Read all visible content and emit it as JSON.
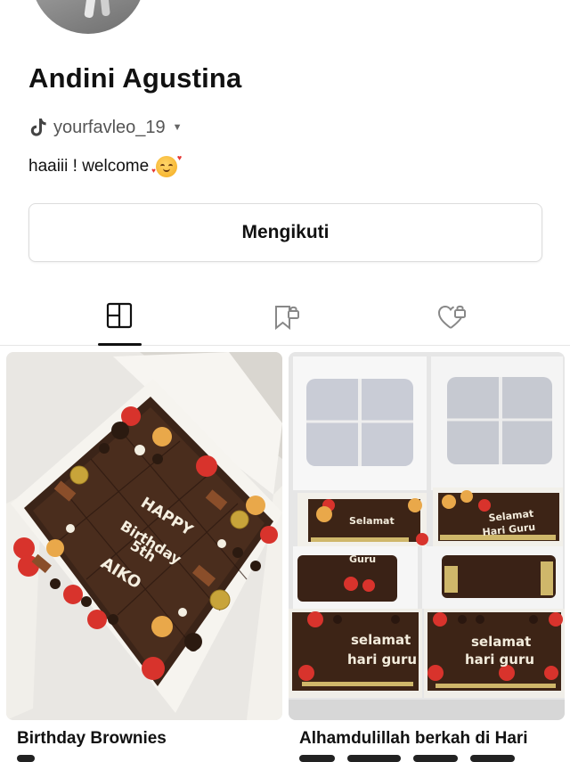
{
  "profile": {
    "name": "Andini Agustina",
    "handle": "yourfavleo_19",
    "bio": "haaiii ! welcome",
    "bio_emoji": "smiling-face-with-hearts"
  },
  "actions": {
    "follow_label": "Mengikuti"
  },
  "tabs": [
    {
      "id": "grid",
      "icon": "grid-layout-icon",
      "active": true
    },
    {
      "id": "saved",
      "icon": "bookmark-lock-icon",
      "active": false
    },
    {
      "id": "liked",
      "icon": "heart-lock-icon",
      "active": false
    }
  ],
  "posts": [
    {
      "title": "Birthday Brownies",
      "image": "brownie box with HAPPY BIRTHDAY 5th AIKO"
    },
    {
      "title": "Alhamdulillah berkah di Hari",
      "image": "four brownie boxes selamat hari guru"
    }
  ],
  "cake_text": {
    "happy": "HAPPY",
    "birthday": "Birthday",
    "fifth": "5th",
    "name": "AIKO",
    "selamat": "Selamat",
    "hari_guru": "Hari Guru",
    "selamat2": "selamat",
    "hari_guru2": "hari guru",
    "guru": "Guru"
  },
  "colors": {
    "text": "#111111",
    "muted": "#555555",
    "border": "#dcdcdc",
    "brownie": "#3b2418",
    "box": "#f5f2ec"
  }
}
